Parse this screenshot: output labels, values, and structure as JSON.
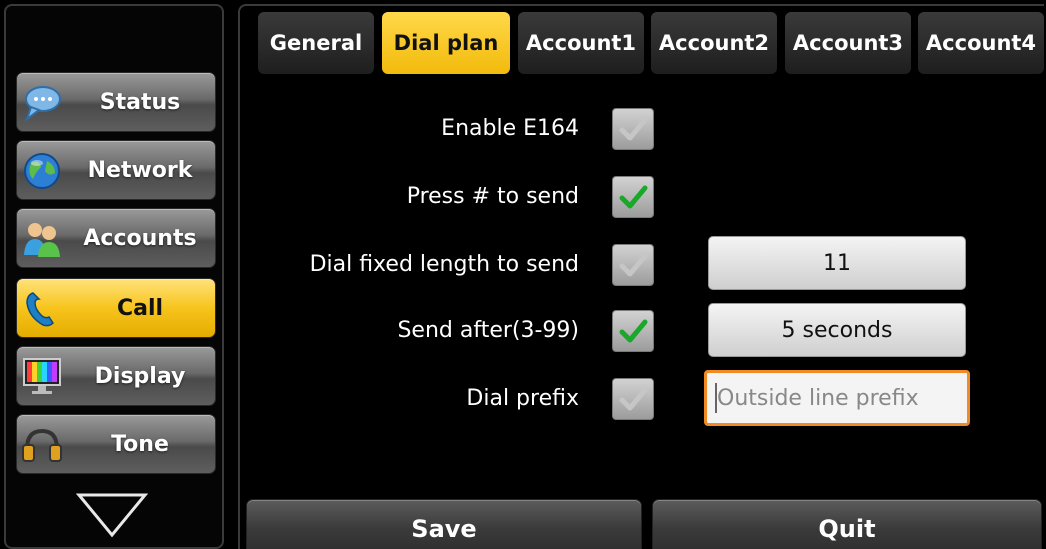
{
  "sidebar": {
    "items": [
      {
        "label": "Status",
        "icon": "chat-bubble-icon",
        "active": false
      },
      {
        "label": "Network",
        "icon": "globe-icon",
        "active": false
      },
      {
        "label": "Accounts",
        "icon": "users-icon",
        "active": false
      },
      {
        "label": "Call",
        "icon": "phone-handset-icon",
        "active": true
      },
      {
        "label": "Display",
        "icon": "monitor-icon",
        "active": false
      },
      {
        "label": "Tone",
        "icon": "headphones-icon",
        "active": false
      }
    ],
    "more_icon": "down-triangle-icon"
  },
  "tabs": [
    {
      "label": "General",
      "active": false
    },
    {
      "label": "Dial plan",
      "active": true
    },
    {
      "label": "Account1",
      "active": false
    },
    {
      "label": "Account2",
      "active": false
    },
    {
      "label": "Account3",
      "active": false
    },
    {
      "label": "Account4",
      "active": false
    }
  ],
  "settings": {
    "enable_e164": {
      "label": "Enable E164",
      "checked": false
    },
    "press_hash": {
      "label": "Press # to send",
      "checked": true
    },
    "fixed_length": {
      "label": "Dial fixed length to send",
      "checked": false,
      "value": "11"
    },
    "send_after": {
      "label": "Send after(3-99)",
      "checked": true,
      "value": "5 seconds"
    },
    "dial_prefix": {
      "label": "Dial prefix",
      "checked": false,
      "value": "",
      "placeholder": "Outside line prefix"
    }
  },
  "footer": {
    "save_label": "Save",
    "quit_label": "Quit"
  },
  "colors": {
    "accent": "#f2bb0c",
    "check_green": "#1aa82a",
    "input_focus": "#f08a24"
  }
}
